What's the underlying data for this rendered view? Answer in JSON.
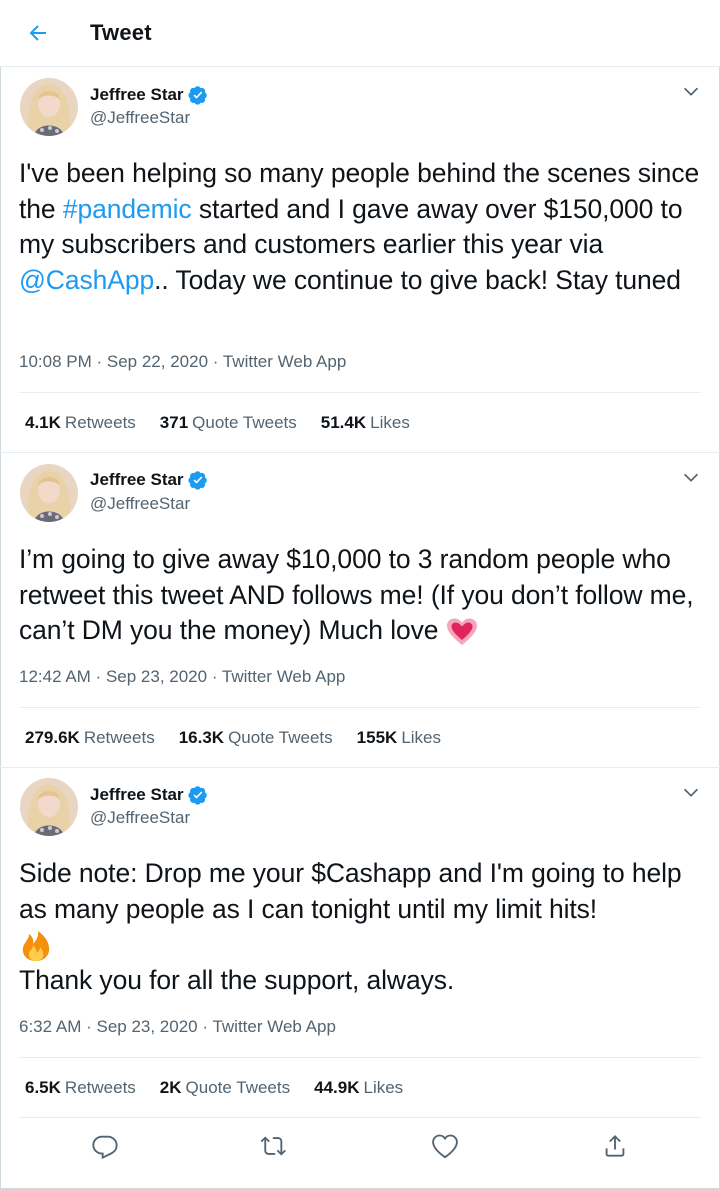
{
  "header": {
    "title": "Tweet"
  },
  "tweets": [
    {
      "name": "Jeffree Star",
      "handle": "@JeffreeStar",
      "text_parts": [
        "I've been helping so many people behind the scenes since the ",
        "#pandemic",
        " started and I gave away over $150,000 to my subscribers and customers earlier this year via ",
        "@CashApp",
        ".. Today we continue to give back! Stay tuned"
      ],
      "time": "10:08 PM",
      "date": "Sep 22, 2020",
      "source": "Twitter Web App",
      "retweets": "4.1K",
      "retweets_label": "Retweets",
      "quotes": "371",
      "quotes_label": "Quote Tweets",
      "likes": "51.4K",
      "likes_label": "Likes"
    },
    {
      "name": "Jeffree Star",
      "handle": "@JeffreeStar",
      "text": "I’m going to give away $10,000 to 3 random people who retweet this tweet AND follows me! (If you don’t follow me, can’t DM you the money) Much love",
      "emoji": "pink-heart-emoji",
      "time": "12:42 AM",
      "date": "Sep 23, 2020",
      "source": "Twitter Web App",
      "retweets": "279.6K",
      "retweets_label": "Retweets",
      "quotes": "16.3K",
      "quotes_label": "Quote Tweets",
      "likes": "155K",
      "likes_label": "Likes"
    },
    {
      "name": "Jeffree Star",
      "handle": "@JeffreeStar",
      "text_line1": "Side note: Drop me your $Cashapp and I'm going to help as many people as I can tonight until my limit hits!",
      "emoji": "fire-emoji",
      "text_line2": "Thank you for all the support, always.",
      "time": "6:32 AM",
      "date": "Sep 23, 2020",
      "source": "Twitter Web App",
      "retweets": "6.5K",
      "retweets_label": "Retweets",
      "quotes": "2K",
      "quotes_label": "Quote Tweets",
      "likes": "44.9K",
      "likes_label": "Likes"
    }
  ],
  "separator": " · ",
  "actions": [
    "reply-icon",
    "retweet-icon",
    "like-icon",
    "share-icon"
  ],
  "colors": {
    "link": "#1d9bf0",
    "verified": "#1d9bf0",
    "secondary_text": "#536471",
    "divider": "#e6ecf0",
    "heart": "#e0245e"
  }
}
